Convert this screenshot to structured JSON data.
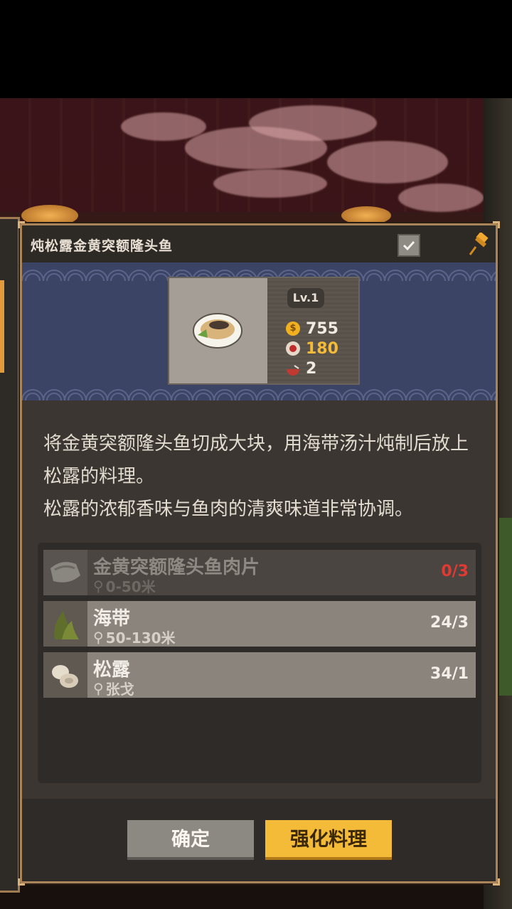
{
  "dialog": {
    "title": "炖松露金黄突额隆头鱼",
    "check_icon": "checkbox-icon",
    "pin_icon": "pin-icon"
  },
  "dish": {
    "image": "braised-fish-dish-icon",
    "level": "Lv.1",
    "price": "755",
    "fans": "180",
    "portions": "2",
    "colors": {
      "price": "#f0ebe2",
      "fans": "#f4bb38",
      "portions": "#f0ebe2"
    }
  },
  "description": {
    "line1": "将金黄突额隆头鱼切成大块，用海带汤汁炖制后放上松露的料理。",
    "line2": "松露的浓郁香味与鱼肉的清爽味道非常协调。"
  },
  "ingredients": [
    {
      "name": "金黄突额隆头鱼肉片",
      "location": "0-50米",
      "count": "0/3",
      "insufficient": true,
      "icon": "fish-fillet-icon"
    },
    {
      "name": "海带",
      "location": "50-130米",
      "count": "24/3",
      "insufficient": false,
      "icon": "kelp-icon"
    },
    {
      "name": "松露",
      "location": "张戈",
      "count": "34/1",
      "insufficient": false,
      "icon": "truffle-icon"
    }
  ],
  "buttons": {
    "confirm": "确定",
    "enhance": "强化料理"
  },
  "colors": {
    "accent": "#f4bb38",
    "insufficient": "#e03a32",
    "banner": "#3c4466"
  }
}
